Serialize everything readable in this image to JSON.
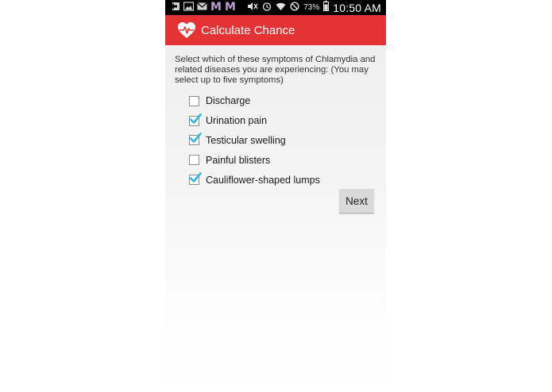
{
  "status_bar": {
    "icons_left": [
      "back-arrow-icon",
      "image-icon",
      "gmail-icon",
      "m-icon",
      "m-icon"
    ],
    "m_glyph": "M",
    "icons_right": [
      "mute-icon",
      "alarm-icon",
      "wifi-icon",
      "blocked-icon",
      "battery-icon"
    ],
    "battery_percent": "73%",
    "time": "10:50 AM"
  },
  "action_bar": {
    "app_icon": "heart-pulse-icon",
    "title": "Calculate Chance",
    "color": "#e53335"
  },
  "main": {
    "instructions": "Select which of these symptoms of Chlamydia and related diseases you are experiencing: (You may select up to five symptoms)",
    "symptoms": [
      {
        "label": "Discharge",
        "checked": false
      },
      {
        "label": "Urination pain",
        "checked": true
      },
      {
        "label": "Testicular swelling",
        "checked": true
      },
      {
        "label": "Painful blisters",
        "checked": false
      },
      {
        "label": "Cauliflower-shaped lumps",
        "checked": true
      }
    ],
    "check_color": "#33b5e5",
    "next_label": "Next"
  }
}
